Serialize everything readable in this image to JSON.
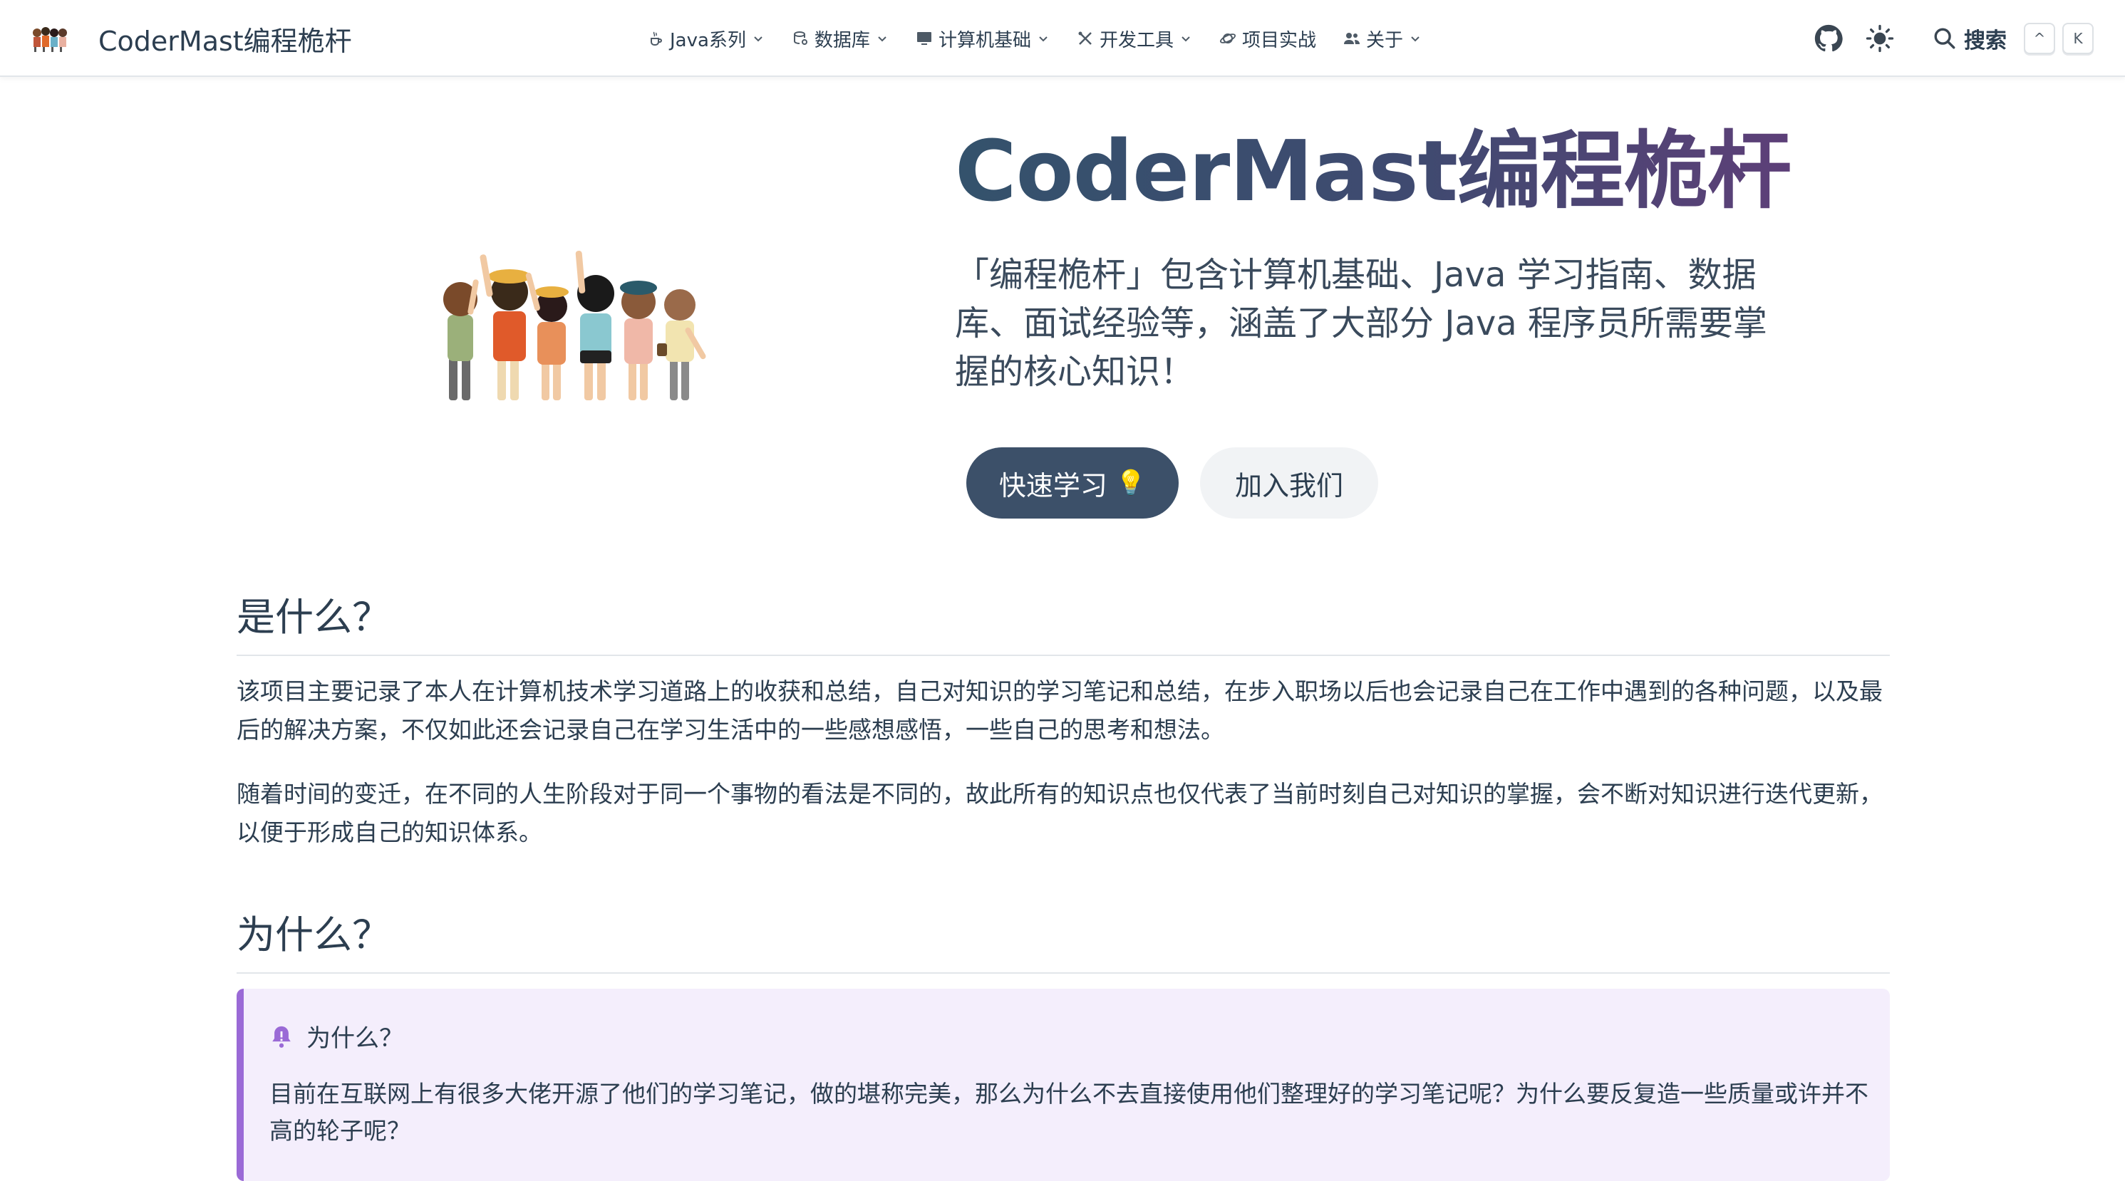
{
  "site": {
    "title": "CoderMast编程桅杆"
  },
  "nav": {
    "items": [
      {
        "label": "Java系列",
        "icon": "java-cup-icon",
        "has_dropdown": true
      },
      {
        "label": "数据库",
        "icon": "database-icon",
        "has_dropdown": true
      },
      {
        "label": "计算机基础",
        "icon": "monitor-icon",
        "has_dropdown": true
      },
      {
        "label": "开发工具",
        "icon": "tools-icon",
        "has_dropdown": true
      },
      {
        "label": "项目实战",
        "icon": "planet-icon",
        "has_dropdown": false
      },
      {
        "label": "关于",
        "icon": "users-icon",
        "has_dropdown": true
      }
    ],
    "github_icon": "github-icon",
    "theme_icon": "sun-icon",
    "search": {
      "label": "搜索",
      "shortcut_keys": [
        "^",
        "K"
      ]
    }
  },
  "hero": {
    "title": "CoderMast编程桅杆",
    "description": "「编程桅杆」包含计算机基础、Java 学习指南、数据库、面试经验等，涵盖了大部分 Java 程序员所需要掌握的核心知识！",
    "primary_button": "快速学习",
    "primary_button_emoji": "💡",
    "secondary_button": "加入我们",
    "image": "group-of-cartoon-kids-illustration"
  },
  "sections": [
    {
      "title": "是什么？",
      "paragraphs": [
        "该项目主要记录了本人在计算机技术学习道路上的收获和总结，自己对知识的学习笔记和总结，在步入职场以后也会记录自己在工作中遇到的各种问题，以及最后的解决方案，不仅如此还会记录自己在学习生活中的一些感想感悟，一些自己的思考和想法。",
        "随着时间的变迁，在不同的人生阶段对于同一个事物的看法是不同的，故此所有的知识点也仅代表了当前时刻自己对知识的掌握，会不断对知识进行迭代更新，以便于形成自己的知识体系。"
      ]
    },
    {
      "title": "为什么？",
      "callout": {
        "icon": "bell-icon",
        "title": "为什么？",
        "body": "目前在互联网上有很多大佬开源了他们的学习笔记，做的堪称完美，那么为什么不去直接使用他们整理好的学习笔记呢？为什么要反复造一些质量或许并不高的轮子呢？"
      }
    }
  ],
  "colors": {
    "primary_button": "#3c5069",
    "callout_bg": "#f4eefc",
    "callout_border": "#9a6ad6",
    "text": "#2c3e50"
  }
}
